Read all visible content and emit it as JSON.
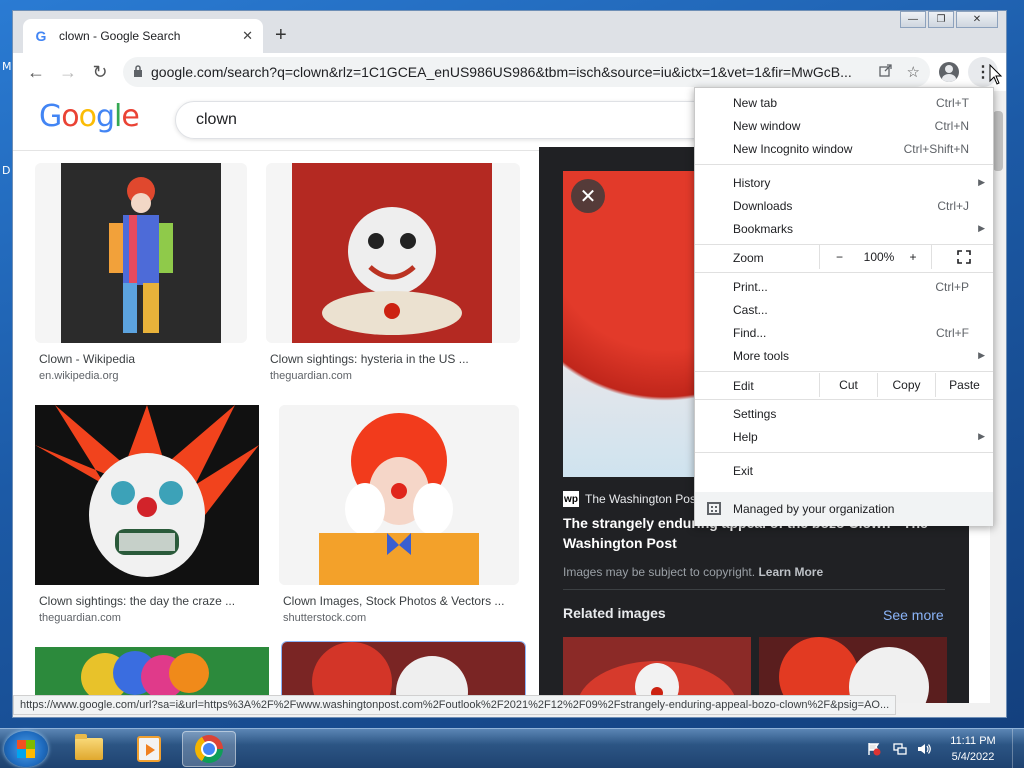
{
  "desktop": {
    "icon_letters": [
      "M",
      "D"
    ]
  },
  "window": {
    "minimize": "—",
    "restore": "❐",
    "close": "✕"
  },
  "tab": {
    "title": "clown - Google Search",
    "favicon": "G",
    "close": "✕",
    "new_tab": "+"
  },
  "toolbar": {
    "back": "←",
    "forward": "→",
    "reload": "↻",
    "url": "google.com/search?q=clown&rlz=1C1GCEA_enUS986US986&tbm=isch&source=iu&ictx=1&vet=1&fir=MwGcB...",
    "share_icon": "share-icon",
    "star": "☆",
    "menu": "⋮"
  },
  "google": {
    "logo_letters": [
      "G",
      "o",
      "o",
      "g",
      "l",
      "e"
    ],
    "logo_colors": [
      "#4285f4",
      "#ea4335",
      "#fbbc05",
      "#4285f4",
      "#34a853",
      "#ea4335"
    ],
    "query": "clown"
  },
  "results": [
    {
      "caption": "Clown - Wikipedia",
      "source": "en.wikipedia.org"
    },
    {
      "caption": "Clown sightings: hysteria in the US ...",
      "source": "theguardian.com"
    },
    {
      "caption": "Clown sightings: the day the craze ...",
      "source": "theguardian.com"
    },
    {
      "caption": "Clown Images, Stock Photos & Vectors ...",
      "source": "shutterstock.com"
    },
    {
      "caption": "",
      "source": ""
    },
    {
      "caption": "",
      "source": ""
    }
  ],
  "preview": {
    "close": "✕",
    "site_logo": "wp",
    "site": "The Washington Post",
    "title": "The strangely enduring appeal of the bozo Clown - The Washington Post",
    "copyright": "Images may be subject to copyright.",
    "learn_more": "Learn More",
    "related": "Related images",
    "see_more": "See more"
  },
  "status_url": "https://www.google.com/url?sa=i&url=https%3A%2F%2Fwww.washingtonpost.com%2Foutlook%2F2021%2F12%2F09%2Fstrangely-enduring-appeal-bozo-clown%2F&psig=AO...",
  "menu": {
    "new_tab": {
      "label": "New tab",
      "shortcut": "Ctrl+T"
    },
    "new_window": {
      "label": "New window",
      "shortcut": "Ctrl+N"
    },
    "new_incognito": {
      "label": "New Incognito window",
      "shortcut": "Ctrl+Shift+N"
    },
    "history": {
      "label": "History"
    },
    "downloads": {
      "label": "Downloads",
      "shortcut": "Ctrl+J"
    },
    "bookmarks": {
      "label": "Bookmarks"
    },
    "zoom": {
      "label": "Zoom",
      "minus": "−",
      "value": "100%",
      "plus": "+"
    },
    "print": {
      "label": "Print...",
      "shortcut": "Ctrl+P"
    },
    "cast": {
      "label": "Cast..."
    },
    "find": {
      "label": "Find...",
      "shortcut": "Ctrl+F"
    },
    "more_tools": {
      "label": "More tools"
    },
    "edit": {
      "label": "Edit",
      "cut": "Cut",
      "copy": "Copy",
      "paste": "Paste"
    },
    "settings": {
      "label": "Settings"
    },
    "help": {
      "label": "Help"
    },
    "exit": {
      "label": "Exit"
    },
    "managed": {
      "label": "Managed by your organization"
    },
    "submenu_arrow": "▶"
  },
  "taskbar": {
    "time": "11:11 PM",
    "date": "5/4/2022",
    "tray_icons": [
      "flag-icon",
      "network-icon",
      "volume-icon"
    ]
  }
}
